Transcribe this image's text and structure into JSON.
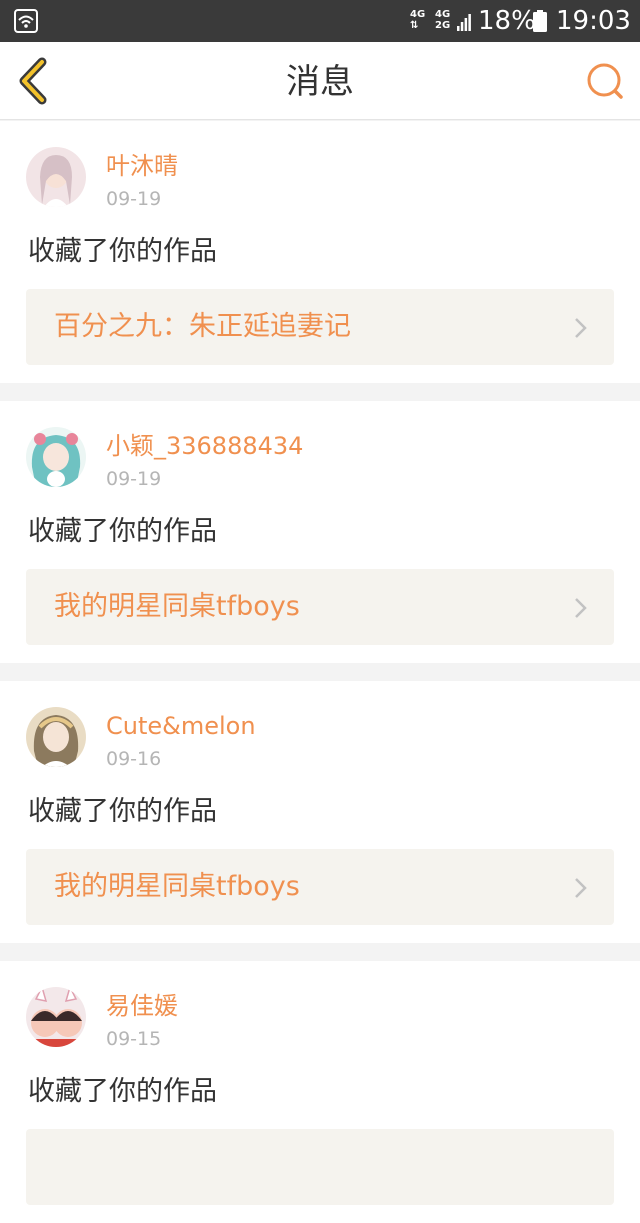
{
  "status_bar": {
    "net_top_a": "4G",
    "net_bottom_a": "⇅",
    "net_top_b": "4G",
    "net_bottom_b": "2G",
    "battery_percent": "18%",
    "time": "19:03"
  },
  "header": {
    "title": "消息",
    "accent_color": "#f0904f"
  },
  "messages": [
    {
      "user_name": "叶沐晴",
      "date": "09-19",
      "action": "收藏了你的作品",
      "work_title": "百分之九：朱正延追妻记",
      "avatar_colors": [
        "#f2e4e6",
        "#d6c0c6"
      ]
    },
    {
      "user_name": "小颖_336888434",
      "date": "09-19",
      "action": "收藏了你的作品",
      "work_title": "我的明星同桌tfboys",
      "avatar_colors": [
        "#bfe6e2",
        "#6fc2c2"
      ]
    },
    {
      "user_name": "Cute&melon",
      "date": "09-16",
      "action": "收藏了你的作品",
      "work_title": "我的明星同桌tfboys",
      "avatar_colors": [
        "#e9dcc4",
        "#8c7a5e"
      ]
    },
    {
      "user_name": "易佳媛",
      "date": "09-15",
      "action": "收藏了你的作品",
      "work_title": "",
      "avatar_colors": [
        "#f6c8b8",
        "#d8463c"
      ]
    }
  ]
}
